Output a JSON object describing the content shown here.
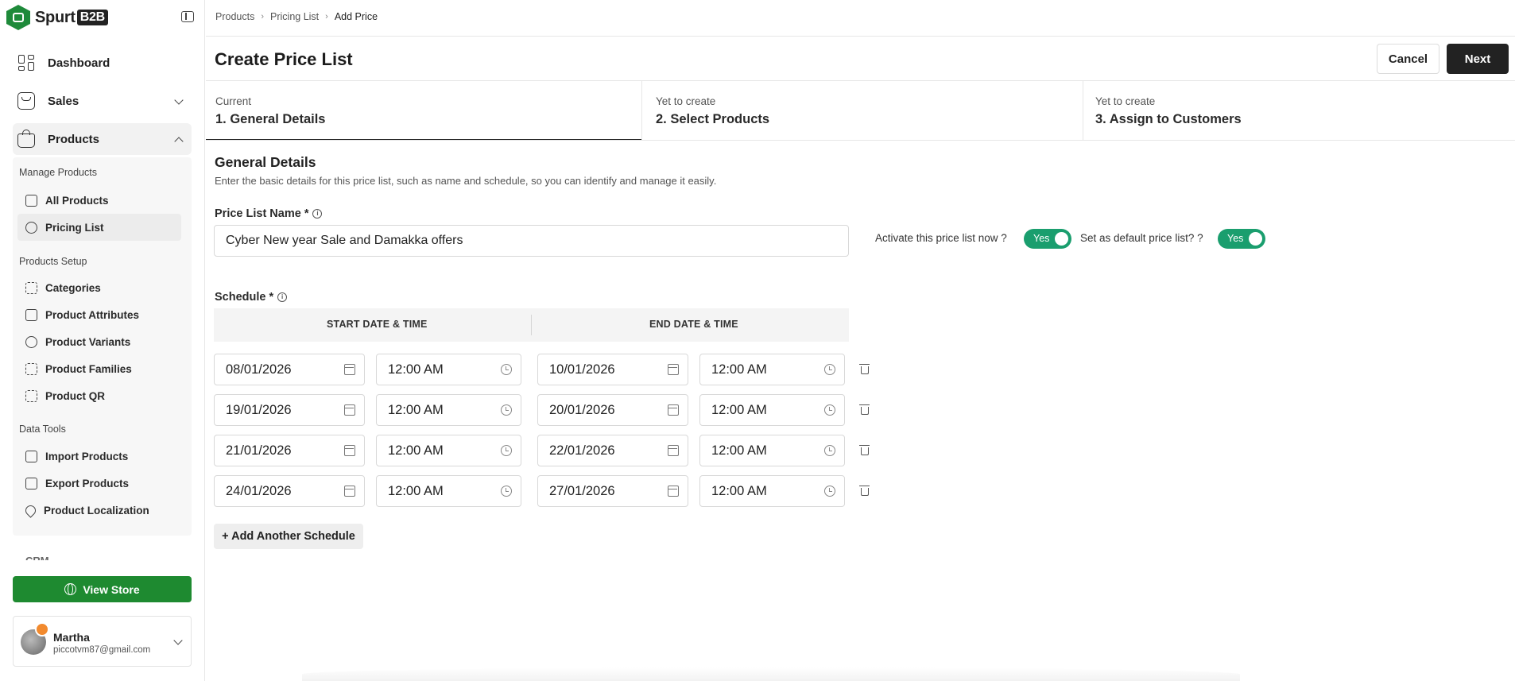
{
  "brand": {
    "name": "Spurt",
    "suffix": "B2B"
  },
  "sidebar": {
    "top": [
      {
        "label": "Dashboard"
      },
      {
        "label": "Sales"
      },
      {
        "label": "Products"
      }
    ],
    "sections": [
      {
        "label": "Manage Products",
        "items": [
          "All Products",
          "Pricing List"
        ]
      },
      {
        "label": "Products Setup",
        "items": [
          "Categories",
          "Product Attributes",
          "Product Variants",
          "Product Families",
          "Product QR"
        ]
      },
      {
        "label": "Data Tools",
        "items": [
          "Import Products",
          "Export Products",
          "Product Localization"
        ]
      }
    ],
    "cropped_item": "CRM",
    "view_store": "View Store",
    "user": {
      "name": "Martha",
      "email": "piccotvm87@gmail.com"
    }
  },
  "breadcrumb": [
    "Products",
    "Pricing List",
    "Add Price"
  ],
  "page": {
    "title": "Create Price List",
    "cancel": "Cancel",
    "next": "Next"
  },
  "steps": [
    {
      "status": "Current",
      "title": "1. General Details"
    },
    {
      "status": "Yet to create",
      "title": "2. Select Products"
    },
    {
      "status": "Yet to create",
      "title": "3. Assign to Customers"
    }
  ],
  "general": {
    "title": "General Details",
    "description": "Enter the basic details for this price list, such as name and schedule, so you can identify and manage it easily.",
    "name_label": "Price List Name *",
    "name_value": "Cyber New year Sale and Damakka offers",
    "activate_label": "Activate this price list now ?",
    "activate_value": "Yes",
    "default_label": "Set as default price list? ?",
    "default_value": "Yes"
  },
  "schedule": {
    "label": "Schedule *",
    "start_header": "START DATE & TIME",
    "end_header": "END DATE & TIME",
    "rows": [
      {
        "start_date": "08/01/2026",
        "start_time": "12:00 AM",
        "end_date": "10/01/2026",
        "end_time": "12:00 AM"
      },
      {
        "start_date": "19/01/2026",
        "start_time": "12:00 AM",
        "end_date": "20/01/2026",
        "end_time": "12:00 AM"
      },
      {
        "start_date": "21/01/2026",
        "start_time": "12:00 AM",
        "end_date": "22/01/2026",
        "end_time": "12:00 AM"
      },
      {
        "start_date": "24/01/2026",
        "start_time": "12:00 AM",
        "end_date": "27/01/2026",
        "end_time": "12:00 AM"
      }
    ],
    "add_label": "+ Add Another Schedule"
  }
}
